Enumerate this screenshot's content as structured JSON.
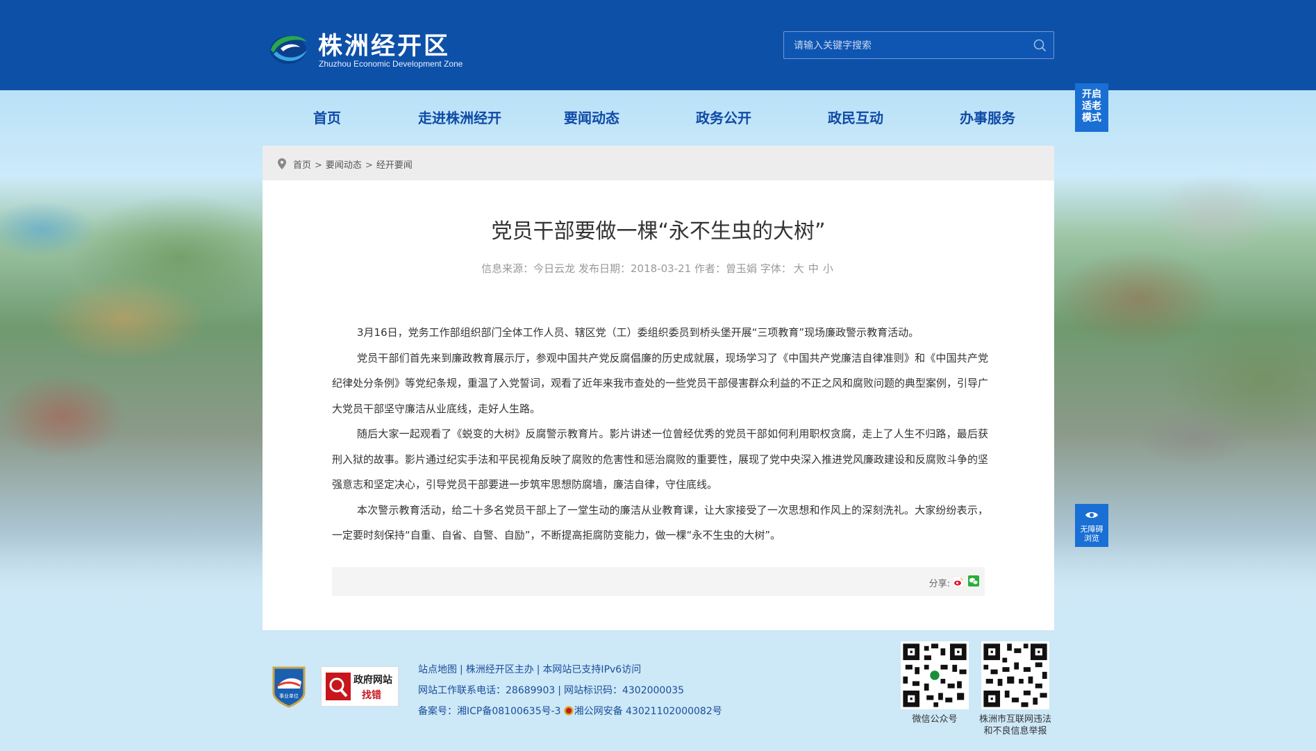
{
  "header": {
    "site_name": "株洲经开区",
    "site_name_en": "Zhuzhou Economic Development Zone",
    "search_placeholder": "请输入关键字搜索"
  },
  "nav": {
    "items": [
      {
        "label": "首页"
      },
      {
        "label": "走进株洲经开"
      },
      {
        "label": "要闻动态"
      },
      {
        "label": "政务公开"
      },
      {
        "label": "政民互动"
      },
      {
        "label": "办事服务"
      }
    ],
    "elder_mode": [
      "开启",
      "适老",
      "模式"
    ]
  },
  "breadcrumb": [
    "首页",
    "要闻动态",
    "经开要闻"
  ],
  "article": {
    "title": "党员干部要做一棵“永不生虫的大树”",
    "meta": {
      "source_label": "信息来源：",
      "source": "今日云龙",
      "date_label": "发布日期：",
      "date": "2018-03-21",
      "author_label": "作者：",
      "author": "曾玉娟",
      "font_label": "字体：",
      "font_sizes": [
        "大",
        "中",
        "小"
      ]
    },
    "paragraphs": [
      "3月16日，党务工作部组织部门全体工作人员、辖区党（工）委组织委员到桥头堡开展“三项教育”现场廉政警示教育活动。",
      "党员干部们首先来到廉政教育展示厅，参观中国共产党反腐倡廉的历史成就展，现场学习了《中国共产党廉洁自律准则》和《中国共产党纪律处分条例》等党纪条规，重温了入党誓词，观看了近年来我市查处的一些党员干部侵害群众利益的不正之风和腐败问题的典型案例，引导广大党员干部坚守廉洁从业底线，走好人生路。",
      "随后大家一起观看了《蜕变的大树》反腐警示教育片。影片讲述一位曾经优秀的党员干部如何利用职权贪腐，走上了人生不归路，最后获刑入狱的故事。影片通过纪实手法和平民视角反映了腐败的危害性和惩治腐败的重要性，展现了党中央深入推进党风廉政建设和反腐败斗争的坚强意志和坚定决心，引导党员干部要进一步筑牢思想防腐墙，廉洁自律，守住底线。",
      "本次警示教育活动，给二十多名党员干部上了一堂生动的廉洁从业教育课，让大家接受了一次思想和作风上的深刻洗礼。大家纷纷表示，一定要时刻保持“自重、自省、自警、自励”，不断提高拒腐防变能力，做一棵“永不生虫的大树”。"
    ],
    "share_label": "分享:"
  },
  "accessibility": {
    "label_line1": "无障碍",
    "label_line2": "浏览"
  },
  "footer": {
    "badge_unit_text": "事业单位",
    "badge_gov_line1": "政府网站",
    "badge_gov_line2": "找错",
    "links": [
      "站点地图",
      "株洲经开区主办",
      "本网站已支持IPv6访问"
    ],
    "phone_label": "网站工作联系电话：",
    "phone": "28689903",
    "site_code_label": "网站标识码：",
    "site_code": "4302000035",
    "icp_label": "备案号：",
    "icp": "湘ICP备08100635号-3",
    "police": "湘公网安备 43021102000082号",
    "qr1_label": "微信公众号",
    "qr2_label_line1": "株洲市互联网违法",
    "qr2_label_line2": "和不良信息举报"
  },
  "colors": {
    "header_blue": "#0d50a8",
    "nav_text": "#0f4aa6",
    "side_button": "#1a6fd4",
    "footer_link": "#1a4f9c"
  }
}
